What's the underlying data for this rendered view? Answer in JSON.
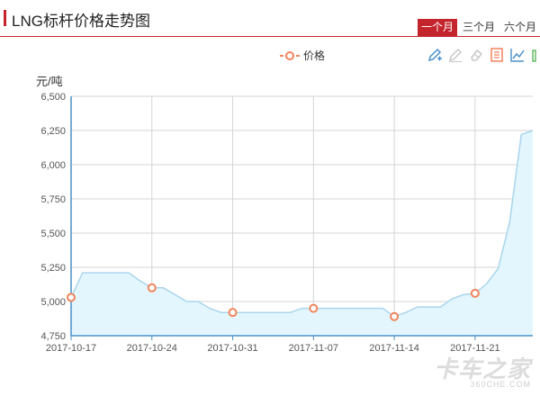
{
  "header": {
    "title": "LNG标杆价格走势图",
    "ranges": [
      {
        "label": "一个月",
        "active": true
      },
      {
        "label": "三个月",
        "active": false
      },
      {
        "label": "六个月",
        "active": false
      }
    ]
  },
  "toolbox": {
    "icons": [
      "pencil-add-icon",
      "pencil-icon",
      "eraser-icon",
      "data-view-icon",
      "line-chart-icon",
      "bar-chart-icon"
    ]
  },
  "colors": {
    "accent": "#c4252d",
    "line": "#a9d5ec",
    "area": "#e4f6fd",
    "marker": "#f2845b",
    "axis": "#4a90c8",
    "grid": "#d5d5d5"
  },
  "watermark": {
    "cn": "卡车之家",
    "en": "360CHE.COM"
  },
  "chart_data": {
    "type": "area",
    "title": "",
    "ylabel": "元/吨",
    "xlabel": "",
    "legend": {
      "entries": [
        "价格"
      ],
      "placement": "top-center"
    },
    "grid": true,
    "ylim": [
      4750,
      6500
    ],
    "yticks": [
      "4,750",
      "5,000",
      "5,250",
      "5,500",
      "5,750",
      "6,000",
      "6,250",
      "6,500"
    ],
    "xticks": [
      "2017-10-17",
      "2017-10-24",
      "2017-10-31",
      "2017-11-07",
      "2017-11-14",
      "2017-11-21"
    ],
    "series": [
      {
        "name": "价格",
        "x": [
          "2017-10-17",
          "2017-10-18",
          "2017-10-19",
          "2017-10-20",
          "2017-10-21",
          "2017-10-22",
          "2017-10-23",
          "2017-10-24",
          "2017-10-25",
          "2017-10-26",
          "2017-10-27",
          "2017-10-28",
          "2017-10-29",
          "2017-10-30",
          "2017-10-31",
          "2017-11-01",
          "2017-11-02",
          "2017-11-03",
          "2017-11-04",
          "2017-11-05",
          "2017-11-06",
          "2017-11-07",
          "2017-11-08",
          "2017-11-09",
          "2017-11-10",
          "2017-11-11",
          "2017-11-12",
          "2017-11-13",
          "2017-11-14",
          "2017-11-15",
          "2017-11-16",
          "2017-11-17",
          "2017-11-18",
          "2017-11-19",
          "2017-11-20",
          "2017-11-21",
          "2017-11-22",
          "2017-11-23",
          "2017-11-24",
          "2017-11-25",
          "2017-11-26"
        ],
        "values": [
          5030,
          5210,
          5210,
          5210,
          5210,
          5210,
          5150,
          5100,
          5100,
          5050,
          5000,
          5000,
          4950,
          4920,
          4920,
          4920,
          4920,
          4920,
          4920,
          4920,
          4950,
          4950,
          4950,
          4950,
          4950,
          4950,
          4950,
          4950,
          4890,
          4920,
          4960,
          4960,
          4960,
          5020,
          5050,
          5060,
          5130,
          5240,
          5580,
          6220,
          6250
        ],
        "markers": [
          "2017-10-17",
          "2017-10-24",
          "2017-10-31",
          "2017-11-07",
          "2017-11-14",
          "2017-11-21"
        ]
      }
    ]
  }
}
